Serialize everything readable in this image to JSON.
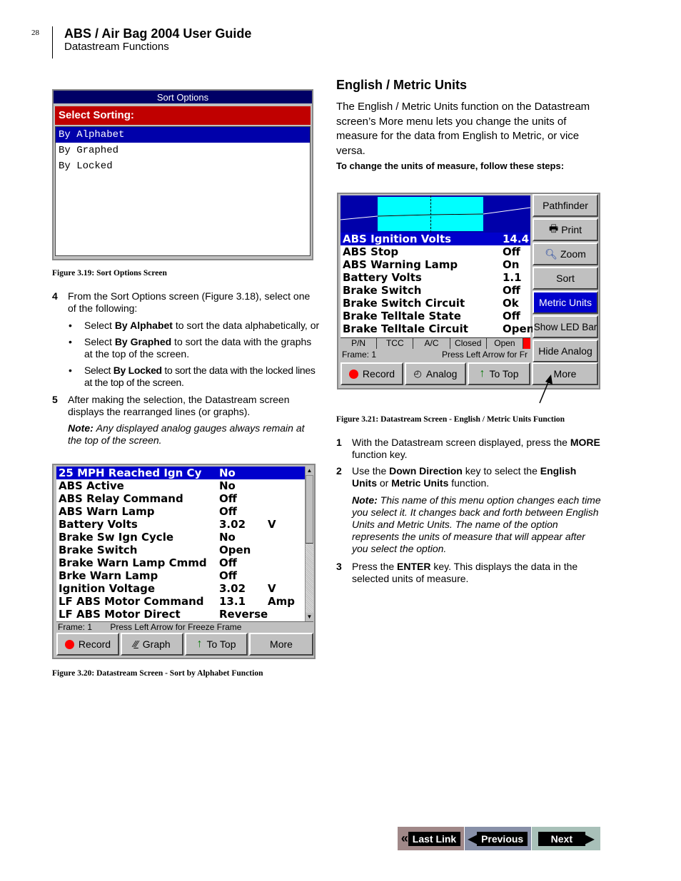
{
  "header": {
    "page_number": "28",
    "title": "ABS / Air Bag 2004 User Guide",
    "subtitle": "Datastream Functions"
  },
  "sort_options": {
    "window_title": "Sort Options",
    "heading": "Select Sorting:",
    "items": [
      {
        "label": "By Alphabet",
        "selected": true
      },
      {
        "label": "By Graphed",
        "selected": false
      },
      {
        "label": "By Locked",
        "selected": false
      }
    ],
    "caption": "Figure 3.19: Sort Options Screen"
  },
  "left_steps": {
    "step4_num": "4",
    "step4_text": "From the Sort Options screen (Figure 3.18), select one of the following:",
    "bullets": [
      {
        "pre": "Select ",
        "bold": "By Alphabet",
        "post": " to sort the data alphabetically, or"
      },
      {
        "pre": "Select ",
        "bold": "By Graphed",
        "post": " to sort the data with the graphs at the top of the screen."
      },
      {
        "pre": "Select ",
        "bold": "By Locked",
        "post": " to sort the data with the locked lines at the top of the screen."
      }
    ],
    "step5_num": "5",
    "step5_text": "After making the selection, the Datastream screen displays the rearranged lines (or graphs).",
    "note_label": "Note:",
    "note_text": "Any displayed analog gauges always remain at the top of the screen."
  },
  "datastream_alpha": {
    "rows": [
      {
        "name": "25 MPH Reached Ign Cy",
        "value": "No",
        "unit": "",
        "selected": true
      },
      {
        "name": "ABS Active",
        "value": "No",
        "unit": ""
      },
      {
        "name": "ABS Relay Command",
        "value": "Off",
        "unit": ""
      },
      {
        "name": "ABS Warn Lamp",
        "value": "Off",
        "unit": ""
      },
      {
        "name": "Battery Volts",
        "value": "3.02",
        "unit": "V"
      },
      {
        "name": "Brake Sw Ign Cycle",
        "value": "No",
        "unit": ""
      },
      {
        "name": "Brake Switch",
        "value": "Open",
        "unit": ""
      },
      {
        "name": "Brake Warn Lamp Cmmd",
        "value": "Off",
        "unit": ""
      },
      {
        "name": "Brke Warn Lamp",
        "value": "Off",
        "unit": ""
      },
      {
        "name": "Ignition Voltage",
        "value": "3.02",
        "unit": "V"
      },
      {
        "name": "LF ABS Motor Command",
        "value": "13.1",
        "unit": "Amp"
      },
      {
        "name": "LF ABS Motor Direct",
        "value": "Reverse",
        "unit": ""
      }
    ],
    "status_frame": "Frame: 1",
    "status_msg": "Press Left Arrow for Freeze Frame",
    "buttons": [
      "Record",
      "Graph",
      "To Top",
      "More"
    ],
    "caption": "Figure 3.20: Datastream Screen - Sort by Alphabet Function"
  },
  "right_section": {
    "heading": "English / Metric Units",
    "intro": "The English / Metric Units function on the Datastream screen’s More menu lets you change the units of measure for the data from English to Metric, or vice versa.",
    "steps_heading": "To change the units of measure, follow these steps:"
  },
  "datastream_metric": {
    "rows": [
      {
        "name": "ABS Ignition Volts",
        "value": "14.4",
        "selected": true
      },
      {
        "name": "ABS Stop",
        "value": "Off"
      },
      {
        "name": "ABS Warning Lamp",
        "value": "On"
      },
      {
        "name": "Battery Volts",
        "value": "1.1"
      },
      {
        "name": "Brake Switch",
        "value": "Off"
      },
      {
        "name": "Brake Switch Circuit",
        "value": "Ok"
      },
      {
        "name": "Brake Telltale State",
        "value": "Off"
      },
      {
        "name": "Brake Telltale Circuit",
        "value": "Open"
      }
    ],
    "led_bar": [
      "P/N",
      "TCC",
      "A/C",
      "Closed",
      "Open"
    ],
    "status_frame": "Frame: 1",
    "status_msg": "Press Left Arrow for Fr",
    "menu": [
      "Pathfinder",
      "Print",
      "Zoom",
      "Sort",
      "Metric Units",
      "Show LED Bar",
      "Hide Analog"
    ],
    "menu_selected": "Metric Units",
    "buttons": [
      "Record",
      "Analog",
      "To Top",
      "More"
    ],
    "caption": "Figure 3.21: Datastream Screen - English / Metric Units Function"
  },
  "right_steps": {
    "s1_num": "1",
    "s1_pre": "With the Datastream screen displayed, press the ",
    "s1_bold": "MORE",
    "s1_post": " function key.",
    "s2_num": "2",
    "s2_pre": "Use the ",
    "s2_b1": "Down Direction",
    "s2_mid": " key to select the ",
    "s2_b2": "English Units",
    "s2_or": " or ",
    "s2_b3": "Metric Units",
    "s2_post": " function.",
    "note_label": "Note:",
    "note_text": "This name of this menu option changes each time you select it. It changes back and forth between English Units and Metric Units. The name of the option represents the units of measure that will appear after you select the option.",
    "s3_num": "3",
    "s3_pre": "Press the ",
    "s3_bold": "ENTER",
    "s3_post": " key. This displays the data in the selected units of measure."
  },
  "nav": {
    "last_link": "Last Link",
    "previous": "Previous",
    "next": "Next"
  },
  "colors": {
    "titlebar": "#000066",
    "sort_heading": "#c00000",
    "selection": "#0000cc",
    "graph_bg": "#0000aa",
    "graph_window": "#00ffff"
  }
}
